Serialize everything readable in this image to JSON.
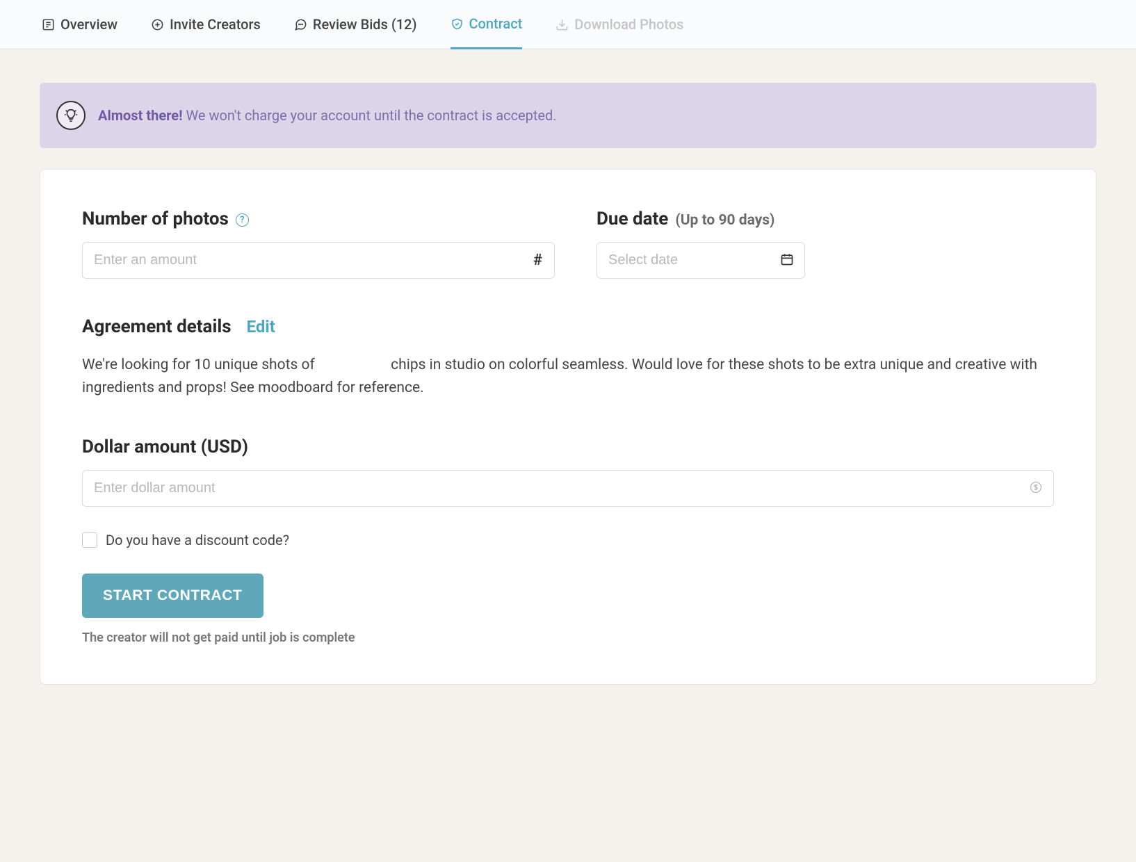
{
  "tabs": {
    "overview": "Overview",
    "invite": "Invite Creators",
    "review": "Review Bids (12)",
    "contract": "Contract",
    "download": "Download Photos"
  },
  "banner": {
    "bold": "Almost there!",
    "rest": " We won't charge your account until the contract is accepted."
  },
  "form": {
    "photos": {
      "label": "Number of photos",
      "placeholder": "Enter an amount",
      "suffix": "#"
    },
    "due": {
      "label": "Due date",
      "sublabel": "(Up to 90 days)",
      "placeholder": "Select date"
    },
    "agreement": {
      "title": "Agreement details",
      "edit": "Edit",
      "body": "We're looking for 10 unique shots of                     chips in studio on colorful seamless. Would love for these shots to be extra unique and creative with ingredients and props! See moodboard for reference."
    },
    "dollar": {
      "label": "Dollar amount (USD)",
      "placeholder": "Enter dollar amount"
    },
    "discount": {
      "label": "Do you have a discount code?"
    },
    "submit": {
      "label": "START CONTRACT",
      "note": "The creator will not get paid until job is complete"
    }
  }
}
